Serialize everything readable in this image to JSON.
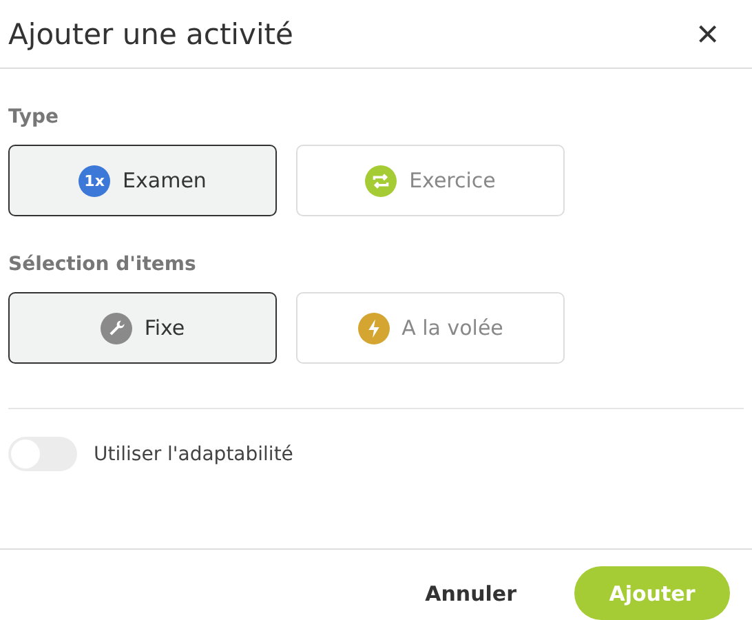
{
  "dialog": {
    "title": "Ajouter une activité",
    "close": "×"
  },
  "sections": [
    {
      "label": "Type",
      "options": [
        {
          "label": "Examen",
          "selected": true,
          "kind": "badge",
          "icon_text": "1x",
          "color": "#3b78d8"
        },
        {
          "label": "Exercice",
          "selected": false,
          "kind": "repeat",
          "color": "#a5cc34"
        }
      ]
    },
    {
      "label": "Sélection d'items",
      "options": [
        {
          "label": "Fixe",
          "selected": true,
          "kind": "wrench",
          "color": "#8a8a8a"
        },
        {
          "label": "A la volée",
          "selected": false,
          "kind": "bolt",
          "color": "#d4a531"
        }
      ]
    }
  ],
  "toggle": {
    "label": "Utiliser l'adaptabilité",
    "on": false
  },
  "buttons": [
    {
      "label": "Annuler",
      "kind": "secondary"
    },
    {
      "label": "Ajouter",
      "kind": "primary"
    }
  ]
}
